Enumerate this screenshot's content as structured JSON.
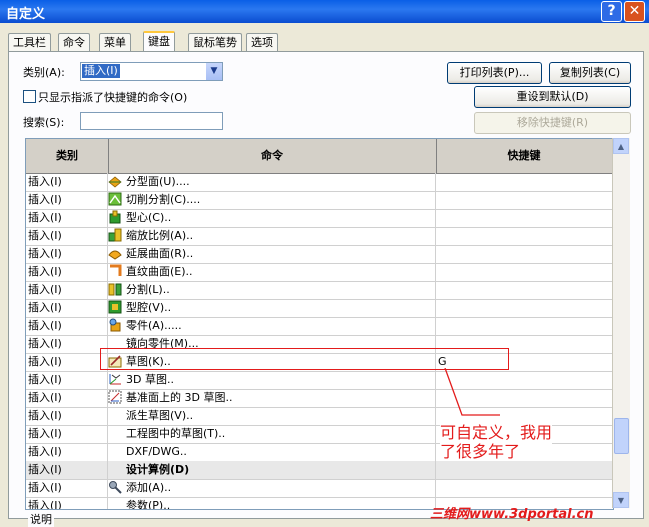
{
  "window": {
    "title": "自定义"
  },
  "tabs": [
    "工具栏",
    "命令",
    "菜单",
    "键盘",
    "鼠标笔势",
    "选项"
  ],
  "category": {
    "label": "类别(A):",
    "value": "插入(I)"
  },
  "show_only_label": "只显示指派了快捷键的命令(O)",
  "search": {
    "label": "搜索(S):",
    "value": ""
  },
  "buttons": {
    "print": "打印列表(P)...",
    "copy": "复制列表(C)",
    "reset": "重设到默认(D)",
    "remove": "移除快捷键(R)"
  },
  "grid": {
    "headers": [
      "类别",
      "命令",
      "快捷键"
    ],
    "rows": [
      {
        "category": "插入(I)",
        "command": "分型面(U)....",
        "shortcut": "",
        "icon": "parting-surface-icon"
      },
      {
        "category": "插入(I)",
        "command": "切削分割(C)....",
        "shortcut": "",
        "icon": "cavity-split-icon"
      },
      {
        "category": "插入(I)",
        "command": "型心(C)..",
        "shortcut": "",
        "icon": "core-icon"
      },
      {
        "category": "插入(I)",
        "command": "缩放比例(A)..",
        "shortcut": "",
        "icon": "scale-icon"
      },
      {
        "category": "插入(I)",
        "command": "延展曲面(R)..",
        "shortcut": "",
        "icon": "extend-surface-icon"
      },
      {
        "category": "插入(I)",
        "command": "直纹曲面(E)..",
        "shortcut": "",
        "icon": "ruled-surface-icon"
      },
      {
        "category": "插入(I)",
        "command": "分割(L)..",
        "shortcut": "",
        "icon": "split-icon"
      },
      {
        "category": "插入(I)",
        "command": "型腔(V)..",
        "shortcut": "",
        "icon": "cavity-icon"
      },
      {
        "category": "插入(I)",
        "command": "零件(A).....",
        "shortcut": "",
        "icon": "part-icon"
      },
      {
        "category": "插入(I)",
        "command": "镜向零件(M)...",
        "shortcut": "",
        "icon": ""
      },
      {
        "category": "插入(I)",
        "command": "草图(K)..",
        "shortcut": "G",
        "icon": "sketch-icon"
      },
      {
        "category": "插入(I)",
        "command": "3D 草图..",
        "shortcut": "",
        "icon": "3d-sketch-icon"
      },
      {
        "category": "插入(I)",
        "command": "基准面上的 3D 草图..",
        "shortcut": "",
        "icon": "3d-sketch-on-plane-icon"
      },
      {
        "category": "插入(I)",
        "command": "派生草图(V)..",
        "shortcut": "",
        "icon": ""
      },
      {
        "category": "插入(I)",
        "command": "工程图中的草图(T)..",
        "shortcut": "",
        "icon": ""
      },
      {
        "category": "插入(I)",
        "command": "DXF/DWG..",
        "shortcut": "",
        "icon": ""
      },
      {
        "category": "插入(I)",
        "command": "设计算例(D)",
        "shortcut": "",
        "icon": "",
        "group": true
      },
      {
        "category": "插入(I)",
        "command": "添加(A)..",
        "shortcut": "",
        "icon": "add-icon"
      },
      {
        "category": "插入(I)",
        "command": "参数(P)..",
        "shortcut": "",
        "icon": ""
      }
    ]
  },
  "annotation": {
    "line1": "可自定义，我用",
    "line2": "了很多年了"
  },
  "watermark": "三维网www.3dportal.cn",
  "description_label": "说明",
  "colors": {
    "title_bar": "#0A5FE6",
    "annotation": "#E31B1B",
    "selection": "#316AC5"
  }
}
